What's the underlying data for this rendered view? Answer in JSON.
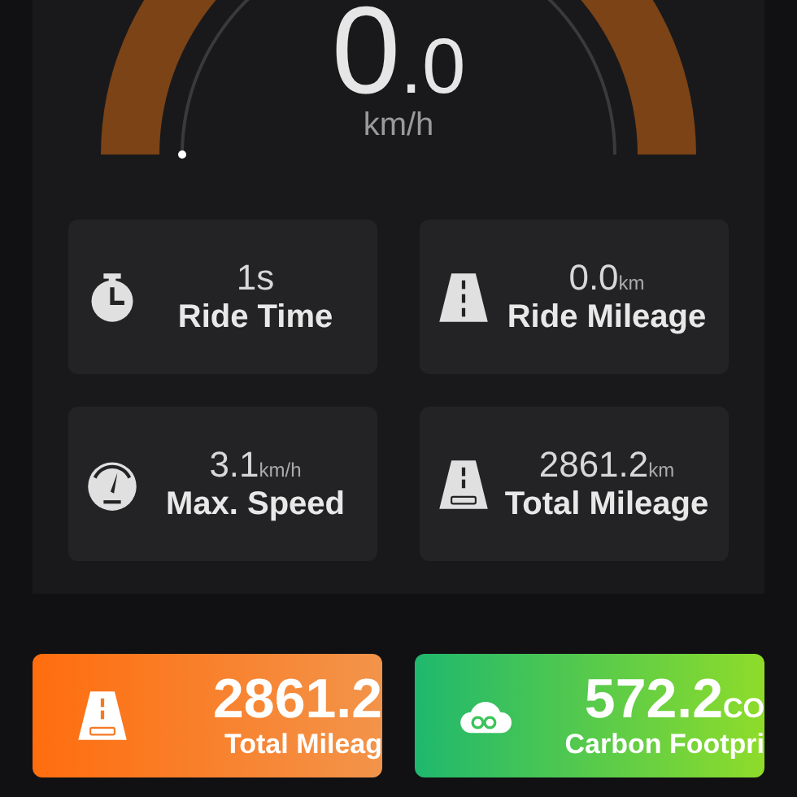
{
  "speedometer": {
    "speed_int": "0",
    "speed_dec": ".0",
    "unit": "km/h"
  },
  "stats": [
    {
      "kind": "timer",
      "value": "1s",
      "label": "Ride Time"
    },
    {
      "kind": "road",
      "value": "0.0",
      "unit": "km",
      "label": "Ride Mileage"
    },
    {
      "kind": "gauge",
      "value": "3.1",
      "unit": "km/h",
      "label": "Max. Speed"
    },
    {
      "kind": "odometer",
      "value": "2861.2",
      "unit": "km",
      "label": "Total Mileage"
    }
  ],
  "summary": [
    {
      "kind": "odometer",
      "value": "2861.2",
      "label": "Total Mileag"
    },
    {
      "kind": "co2",
      "value": "572.2",
      "unit": "CO",
      "label": "Carbon Footpri"
    }
  ]
}
